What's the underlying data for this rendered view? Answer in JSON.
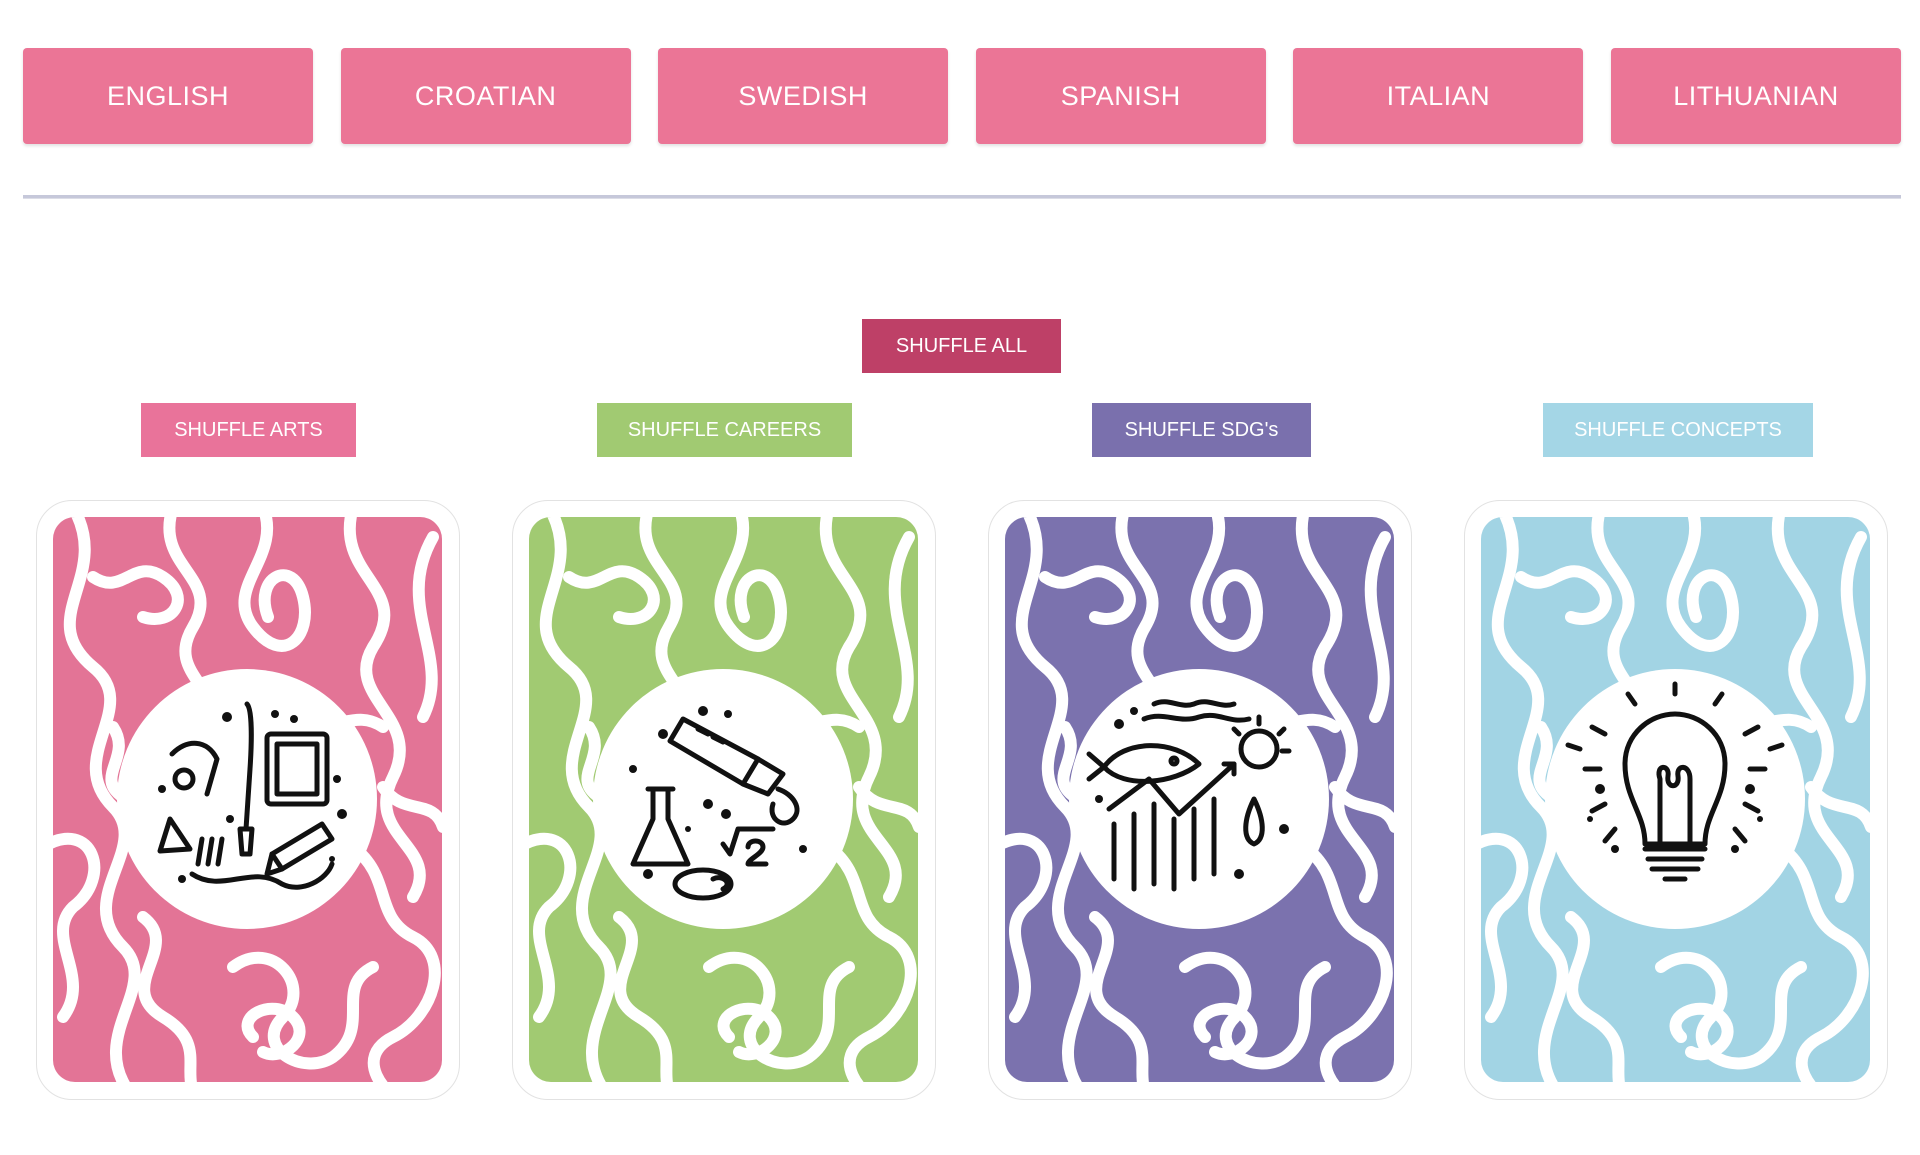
{
  "languages": [
    "ENGLISH",
    "CROATIAN",
    "SWEDISH",
    "SPANISH",
    "ITALIAN",
    "LITHUANIAN"
  ],
  "shuffle_all_label": "SHUFFLE ALL",
  "decks": [
    {
      "button_label": "SHUFFLE ARTS",
      "color": "#e37496",
      "button_color": "#e9739a",
      "icon": "arts-icon"
    },
    {
      "button_label": "SHUFFLE CAREERS",
      "color": "#a1ca72",
      "button_color": "#a1ca72",
      "icon": "careers-icon"
    },
    {
      "button_label": "SHUFFLE SDG's",
      "color": "#7b72ae",
      "button_color": "#7a70ad",
      "icon": "sdgs-icon"
    },
    {
      "button_label": "SHUFFLE CONCEPTS",
      "color": "#a2d4e4",
      "button_color": "#a4d6e6",
      "icon": "concepts-icon"
    }
  ],
  "colors": {
    "language_button": "#eb7596",
    "shuffle_all": "#be4067",
    "divider": "#c6c8da"
  }
}
